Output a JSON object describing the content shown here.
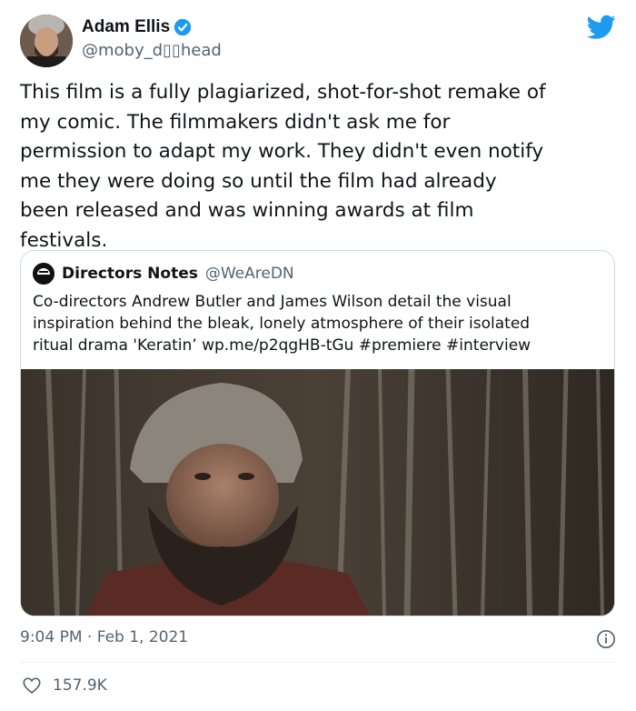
{
  "author": {
    "name": "Adam Ellis",
    "handle": "@moby_d▯▯head",
    "verified": true
  },
  "tweet": {
    "lines": [
      "This film is a fully plagiarized, shot-for-shot remake of",
      "my comic. The filmmakers didn't ask me for",
      "permission to adapt my work. They didn't even notify",
      "me they were doing so until the film had already",
      "been released and was winning awards at film",
      "festivals."
    ]
  },
  "quoted": {
    "name": "Directors Notes",
    "handle": "@WeAreDN",
    "lines": [
      "Co-directors Andrew Butler and James Wilson detail the visual",
      "inspiration behind the bleak, lonely atmosphere of their isolated",
      "ritual drama 'Keratin’ wp.me/p2qgHB-tGu #premiere #interview"
    ]
  },
  "meta": {
    "time": "9:04 PM",
    "separator": "·",
    "date": "Feb 1, 2021"
  },
  "stats": {
    "likes": "157.9K"
  },
  "colors": {
    "twitter_blue": "#1d9bf0",
    "text": "#0f1419",
    "secondary": "#536471"
  },
  "icons": [
    "twitter-bird-icon",
    "verified-badge-icon",
    "info-icon",
    "heart-icon"
  ]
}
